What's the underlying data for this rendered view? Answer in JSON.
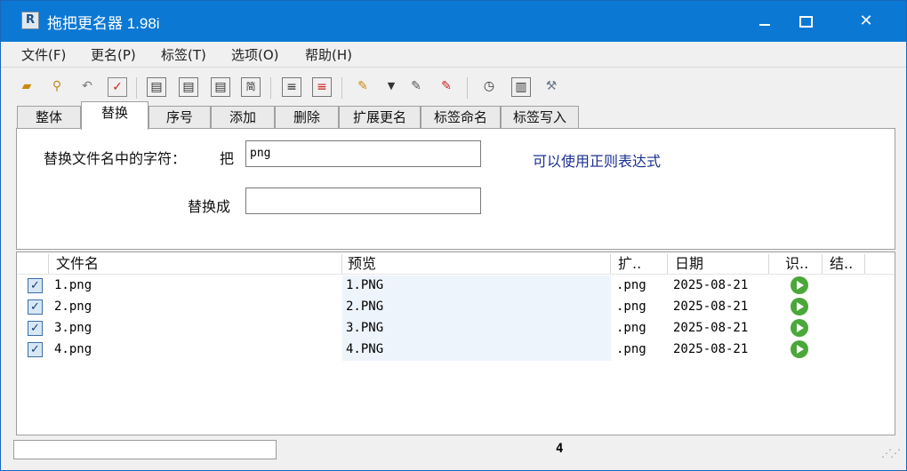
{
  "window": {
    "title": "拖把更名器 1.98i",
    "app_icon_char": "R"
  },
  "menu": [
    "文件(F)",
    "更名(P)",
    "标签(T)",
    "选项(O)",
    "帮助(H)"
  ],
  "tabs": [
    "整体",
    "替换",
    "序号",
    "添加",
    "删除",
    "扩展更名",
    "标签命名",
    "标签写入"
  ],
  "active_tab": "替换",
  "replace_panel": {
    "find_label": "替换文件名中的字符：",
    "find_prefix": "把",
    "find_value": "png",
    "replace_label": "替换成",
    "replace_value": "",
    "hint": "可以使用正则表达式"
  },
  "table": {
    "columns": [
      "文件名",
      "预览",
      "扩..",
      "日期",
      "识..",
      "结.."
    ],
    "rows": [
      {
        "name": "1.png",
        "preview": "1.PNG",
        "ext": ".png",
        "date": "2025-08-21"
      },
      {
        "name": "2.png",
        "preview": "2.PNG",
        "ext": ".png",
        "date": "2025-08-21"
      },
      {
        "name": "3.png",
        "preview": "3.PNG",
        "ext": ".png",
        "date": "2025-08-21"
      },
      {
        "name": "4.png",
        "preview": "4.PNG",
        "ext": ".png",
        "date": "2025-08-21"
      }
    ]
  },
  "status": {
    "count": "4"
  },
  "toolbar_icons": [
    "open-folder-icon",
    "search-icon",
    "undo-icon",
    "check-icon",
    "file-a-icon",
    "file-b-icon",
    "file-c-icon",
    "file-d-icon",
    "list-icon",
    "list-delete-icon",
    "pencil-folder-icon",
    "dropdown-icon",
    "edit-icon",
    "edit-delete-icon",
    "clock-icon",
    "preview-icon",
    "tools-icon"
  ]
}
